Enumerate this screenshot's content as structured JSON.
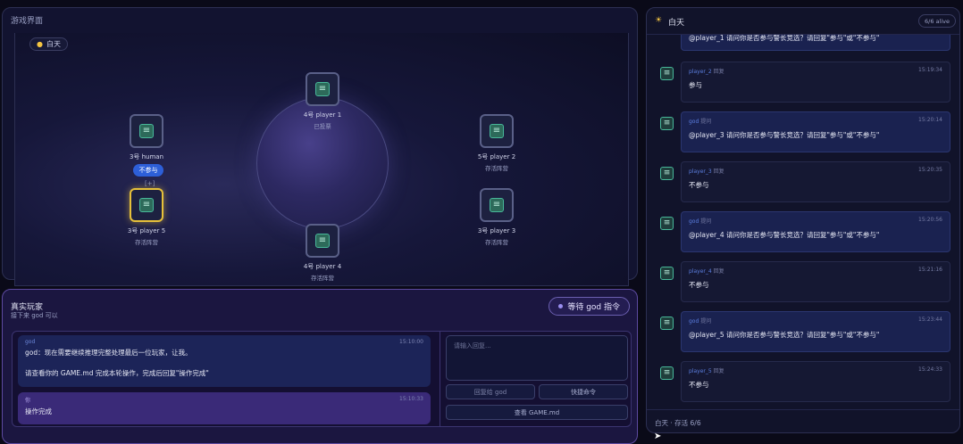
{
  "game": {
    "title": "游戏界面",
    "phase": "白天",
    "vote_bubble": "不参与",
    "vote_link": "[+]",
    "seats": [
      {
        "name": "3号 human",
        "status": ""
      },
      {
        "name": "4号 player 1",
        "status": "已投票"
      },
      {
        "name": "5号 player 2",
        "status": "存活阵营"
      },
      {
        "name": "3号 player 3",
        "status": "存活阵营"
      },
      {
        "name": "4号 player 4",
        "status": "存活阵营"
      },
      {
        "name": "3号 player 5",
        "status": "存活阵营"
      }
    ]
  },
  "player": {
    "title": "真实玩家",
    "subtitle": "接下来 god 可以",
    "wait_badge": "等待 god 指令",
    "messages": [
      {
        "who": "god",
        "time": "15:10:00",
        "text": "god：现在需要继续推理完整处理最后一位玩家，让我。\n\n请查看你的 GAME.md 完成本轮操作，完成后回复\"操作完成\""
      },
      {
        "who": "你",
        "time": "15:10:33",
        "text": "操作完成"
      }
    ],
    "input_placeholder": "请输入回复...",
    "send_label": "回复给 god",
    "shortcut_label": "快捷命令",
    "view_label": "查看 GAME.md"
  },
  "log": {
    "title": "白天",
    "alive": "6/6 alive",
    "top_partial": "@player_1 请问你是否参与警长竞选？请回复\"参与\"或\"不参与\"",
    "entries": [
      {
        "who": "player_2",
        "tag": "回复",
        "time": "15:19:34",
        "text": "参与",
        "god": false
      },
      {
        "who": "god",
        "tag": "提问",
        "time": "15:20:14",
        "text": "@player_3 请问你是否参与警长竞选？请回复\"参与\"或\"不参与\"",
        "god": true
      },
      {
        "who": "player_3",
        "tag": "回复",
        "time": "15:20:35",
        "text": "不参与",
        "god": false
      },
      {
        "who": "god",
        "tag": "提问",
        "time": "15:20:56",
        "text": "@player_4 请问你是否参与警长竞选？请回复\"参与\"或\"不参与\"",
        "god": true
      },
      {
        "who": "player_4",
        "tag": "回复",
        "time": "15:21:16",
        "text": "不参与",
        "god": false
      },
      {
        "who": "god",
        "tag": "提问",
        "time": "15:23:44",
        "text": "@player_5 请问你是否参与警长竞选？请回复\"参与\"或\"不参与\"",
        "god": true
      },
      {
        "who": "player_5",
        "tag": "回复",
        "time": "15:24:33",
        "text": "不参与",
        "god": false
      }
    ],
    "footer": "白天 · 存活 6/6"
  }
}
